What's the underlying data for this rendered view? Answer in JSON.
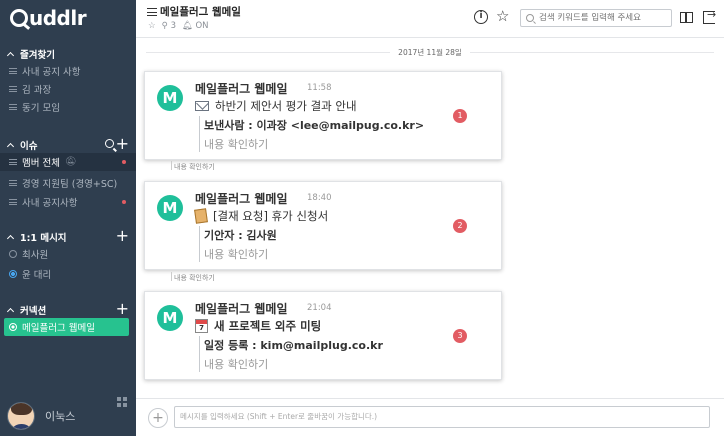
{
  "app": {
    "logo_text": "uddlr"
  },
  "sidebar": {
    "favorites": {
      "title": "즐겨찾기",
      "items": [
        {
          "label": "사내 공지 사항"
        },
        {
          "label": "김 과장"
        },
        {
          "label": "동기 모임"
        }
      ]
    },
    "issues": {
      "title": "이슈",
      "items": [
        {
          "label": "멤버 전체",
          "muted": true,
          "unread": true
        },
        {
          "label": "경영 지원팀 (경영+SC)",
          "unread": false
        },
        {
          "label": "사내 공지사항",
          "unread": true
        }
      ]
    },
    "dm": {
      "title": "1:1 메시지",
      "items": [
        {
          "label": "최사원",
          "online": false
        },
        {
          "label": "윤 대리",
          "online": true
        }
      ]
    },
    "connections": {
      "title": "커넥션",
      "items": [
        {
          "label": "메일플러그 웹메일",
          "selected": true
        }
      ]
    },
    "profile": {
      "name": "이눅스"
    }
  },
  "header": {
    "title": "메일플러그 웹메일",
    "members": "3",
    "notify": "ON",
    "search_placeholder": "검색 키워드를 입력해 주세요"
  },
  "main": {
    "date": "2017년 11월 28일",
    "cards": [
      {
        "sender": "메일플러그 웹메일",
        "avatar": "M",
        "time": "11:58",
        "icon": "envelope-icon",
        "subject": "하반기 제안서 평가 결과 안내",
        "meta": "보낸사람 : 이과장 <lee@mailpug.co.kr>",
        "confirm": "내용 확인하기",
        "badge": "1",
        "receipt": "내용 확인하기"
      },
      {
        "sender": "메일플러그 웹메일",
        "avatar": "M",
        "time": "18:40",
        "icon": "document-icon",
        "subject": "[결재 요청] 휴가 신청서",
        "meta": "기안자 : 김사원",
        "confirm": "내용 확인하기",
        "badge": "2",
        "receipt": "내용 확인하기"
      },
      {
        "sender": "메일플러그 웹메일",
        "avatar": "M",
        "time": "21:04",
        "icon": "calendar-icon",
        "cal_day": "7",
        "subject": "새 프로젝트 외주 미팅",
        "meta": "일정 등록 : kim@mailplug.co.kr",
        "confirm": "내용 확인하기",
        "badge": "3"
      }
    ]
  },
  "composer": {
    "placeholder": "메시지를 입력하세요 (Shift + Enter로 줄바꿈이 가능합니다.)"
  },
  "colors": {
    "sidebar_bg": "#2f3e4f",
    "accent_green": "#27c28f",
    "badge_red": "#e25c63",
    "avatar_teal": "#1fbf9a"
  }
}
